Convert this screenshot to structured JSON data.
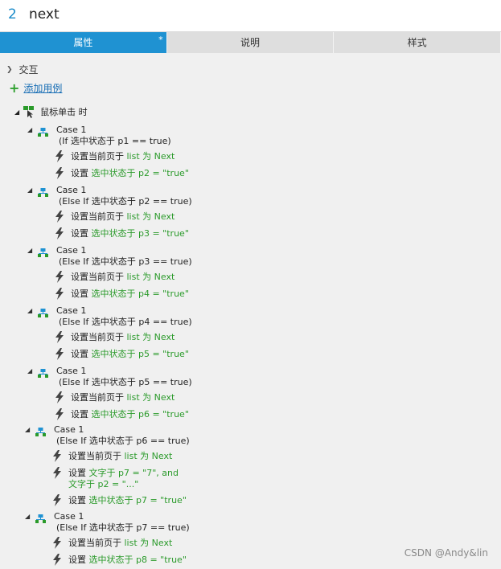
{
  "title": {
    "number": "2",
    "name": "next"
  },
  "tabs": [
    {
      "label": "属性",
      "active": true,
      "marker": "*"
    },
    {
      "label": "说明",
      "active": false
    },
    {
      "label": "样式",
      "active": false
    }
  ],
  "section_title": "交互",
  "add_case_label": "添加用例",
  "event_label": "鼠标单击 时",
  "cases": [
    {
      "name": "Case 1",
      "condition": "(If 选中状态于 p1 == true)",
      "actions": [
        {
          "verb": "设置当前页于",
          "detail": "list 为 Next"
        },
        {
          "verb": "设置",
          "detail": "选中状态于 p2 = \"true\""
        }
      ]
    },
    {
      "name": "Case 1",
      "condition": "(Else If 选中状态于 p2 == true)",
      "actions": [
        {
          "verb": "设置当前页于",
          "detail": "list 为 Next"
        },
        {
          "verb": "设置",
          "detail": "选中状态于 p3 = \"true\""
        }
      ]
    },
    {
      "name": "Case 1",
      "condition": "(Else If 选中状态于 p3 == true)",
      "actions": [
        {
          "verb": "设置当前页于",
          "detail": "list 为 Next"
        },
        {
          "verb": "设置",
          "detail": "选中状态于 p4 = \"true\""
        }
      ]
    },
    {
      "name": "Case 1",
      "condition": "(Else If 选中状态于 p4 == true)",
      "actions": [
        {
          "verb": "设置当前页于",
          "detail": "list 为 Next"
        },
        {
          "verb": "设置",
          "detail": "选中状态于 p5 = \"true\""
        }
      ]
    },
    {
      "name": "Case 1",
      "condition": "(Else If 选中状态于 p5 == true)",
      "actions": [
        {
          "verb": "设置当前页于",
          "detail": "list 为 Next"
        },
        {
          "verb": "设置",
          "detail": "选中状态于 p6 = \"true\""
        }
      ]
    },
    {
      "name": "Case 1",
      "condition": "(Else If 选中状态于 p6 == true)",
      "actions": [
        {
          "verb": "设置当前页于",
          "detail": "list 为 Next"
        },
        {
          "verb": "设置",
          "detail": "文字于 p7 = \"7\", and",
          "detail2": "文字于 p2 = \"...\""
        },
        {
          "verb": "设置",
          "detail": "选中状态于 p7 = \"true\""
        }
      ]
    },
    {
      "name": "Case 1",
      "condition": "(Else If 选中状态于 p7 == true)",
      "actions": [
        {
          "verb": "设置当前页于",
          "detail": "list 为 Next"
        },
        {
          "verb": "设置",
          "detail": "选中状态于 p8 = \"true\""
        }
      ]
    }
  ],
  "watermark": "CSDN @Andy&lin",
  "colors": {
    "accent": "#1f92d2",
    "green": "#2a9a2a",
    "link": "#1a6fb5"
  }
}
